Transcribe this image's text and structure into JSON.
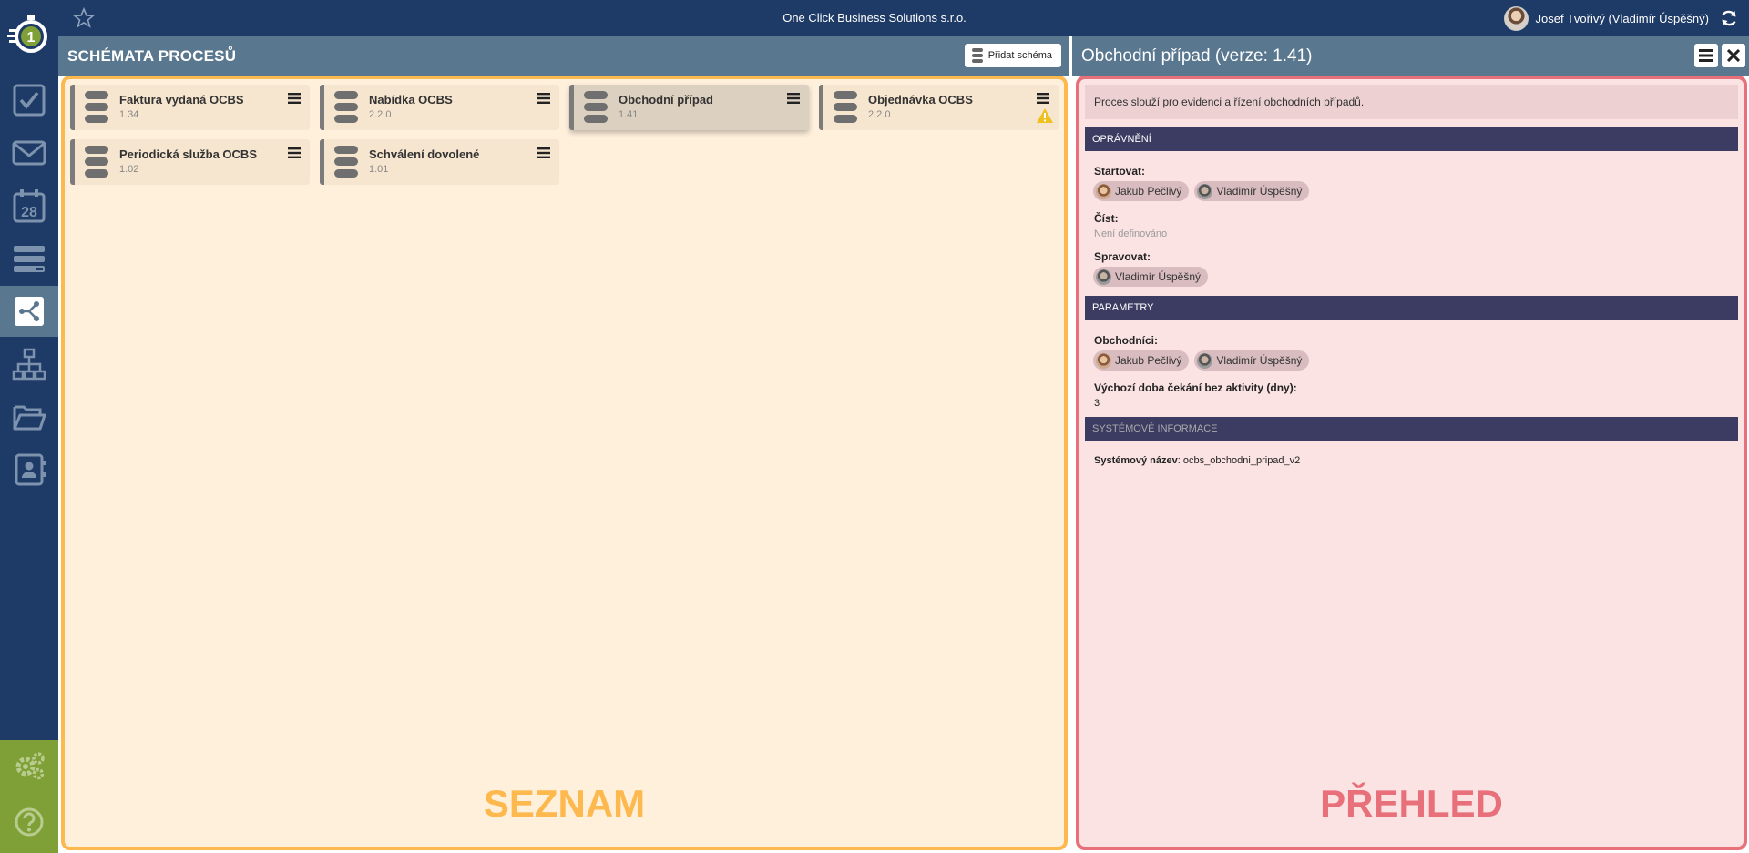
{
  "topbar": {
    "company": "One Click Business Solutions s.r.o.",
    "user": "Josef Tvořivý (Vladimír Úspěšný)"
  },
  "sidebar": {
    "items": [
      {
        "name": "tasks",
        "icon": "checkbox-icon"
      },
      {
        "name": "messages",
        "icon": "envelope-icon"
      },
      {
        "name": "calendar",
        "icon": "calendar-icon",
        "label": "28"
      },
      {
        "name": "list",
        "icon": "list-icon"
      },
      {
        "name": "processes",
        "icon": "process-schema-icon",
        "active": true
      },
      {
        "name": "org",
        "icon": "org-chart-icon"
      },
      {
        "name": "files",
        "icon": "folder-open-icon"
      },
      {
        "name": "contacts",
        "icon": "address-book-icon"
      }
    ],
    "bottom": [
      {
        "name": "settings",
        "icon": "gears-icon"
      },
      {
        "name": "help",
        "icon": "help-icon"
      }
    ]
  },
  "left": {
    "title": "SCHÉMATA PROCESŮ",
    "add_label": "Přidat schéma",
    "cards": [
      {
        "name": "Faktura vydaná OCBS",
        "version": "1.34"
      },
      {
        "name": "Nabídka OCBS",
        "version": "2.2.0"
      },
      {
        "name": "Obchodní případ",
        "version": "1.41",
        "selected": true
      },
      {
        "name": "Objednávka OCBS",
        "version": "2.2.0",
        "warning": true
      },
      {
        "name": "Periodická služba OCBS",
        "version": "1.02"
      },
      {
        "name": "Schválení dovolené",
        "version": "1.01"
      }
    ],
    "overlay_label": "SEZNAM"
  },
  "right": {
    "title": "Obchodní případ (verze: 1.41)",
    "description": "Proces slouží pro evidenci a řízení obchodních případů.",
    "sections": {
      "permissions": "OPRÁVNĚNÍ",
      "parameters": "PARAMETRY",
      "system": "SYSTÉMOVÉ INFORMACE"
    },
    "start_label": "Startovat:",
    "start_users": [
      "Jakub Pečlivý",
      "Vladimír Úspěšný"
    ],
    "read_label": "Číst:",
    "read_value": "Není definováno",
    "manage_label": "Spravovat:",
    "manage_users": [
      "Vladimír Úspěšný"
    ],
    "traders_label": "Obchodníci:",
    "traders": [
      "Jakub Pečlivý",
      "Vladimír Úspěšný"
    ],
    "wait_label": "Výchozí doba čekání bez aktivity (dny):",
    "wait_value": "3",
    "sysname_label": "Systémový název",
    "sysname_value": "ocbs_obchodni_pripad_v2",
    "overlay_label": "PŘEHLED"
  },
  "colors": {
    "topbar": "#1e3a66",
    "header": "#5a7790",
    "list_border": "#fdb84e",
    "detail_border": "#e8707a",
    "sidebar_bottom": "#7fa036"
  }
}
